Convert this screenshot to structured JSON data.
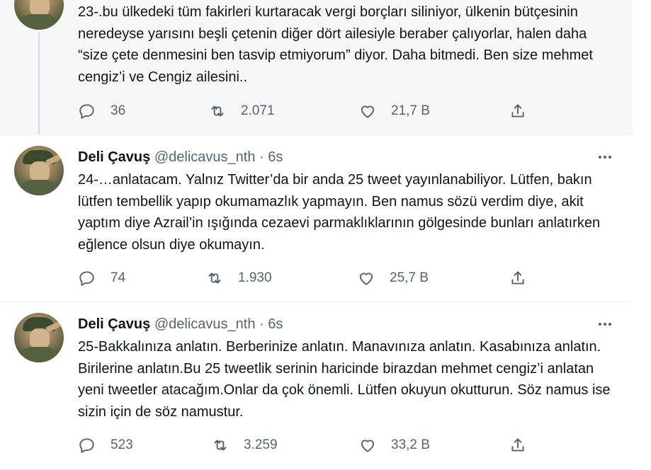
{
  "tweets": [
    {
      "text": "23-.bu ülkedeki tüm fakirleri kurtaracak vergi borçları siliniyor, ülkenin bütçesinin neredeyse yarısını beşli çetenin diğer dört ailesiyle beraber çalıyorlar, halen daha “size çete denmesini ben tasvip etmiyorum” diyor. Daha bitmedi. Ben size mehmet cengiz’i ve Cengiz ailesini..",
      "replies": "36",
      "retweets": "2.071",
      "likes": "21,7 B"
    },
    {
      "name": "Deli Çavuş",
      "handle": "@delicavus_nth",
      "sep": "·",
      "time": "6s",
      "text": "24-…anlatacam. Yalnız Twitter’da bir anda 25 tweet yayınlanabiliyor. Lütfen, bakın lütfen tembellik yapıp okumamazlık yapmayın. Ben namus sözü verdim diye, akit yaptım diye Azrail’in ışığında cezaevi parmaklıklarının gölgesinde bunları anlatırken eğlence olsun diye okumayın.",
      "replies": "74",
      "retweets": "1.930",
      "likes": "25,7 B"
    },
    {
      "name": "Deli Çavuş",
      "handle": "@delicavus_nth",
      "sep": "·",
      "time": "6s",
      "text": "25-Bakkalınıza anlatın. Berberinize anlatın. Manavınıza anlatın. Kasabınıza anlatın. Birilerine anlatın.Bu 25 tweetlik serinin haricinde birazdan mehmet cengiz’i anlatan yeni tweetler atacağım.Onlar da çok önemli. Lütfen okuyun okutturun. Söz namus ise sizin için de söz namustur.",
      "replies": "523",
      "retweets": "3.259",
      "likes": "33,2 B"
    }
  ],
  "icons": {
    "reply": "reply-icon",
    "retweet": "retweet-icon",
    "like": "heart-icon",
    "share": "share-icon",
    "more": "more-dots-icon"
  },
  "colors": {
    "text": "#0f1419",
    "secondary": "#536471",
    "thread_line": "#cfd9de",
    "highlight_bg": "#f7f7f7"
  }
}
